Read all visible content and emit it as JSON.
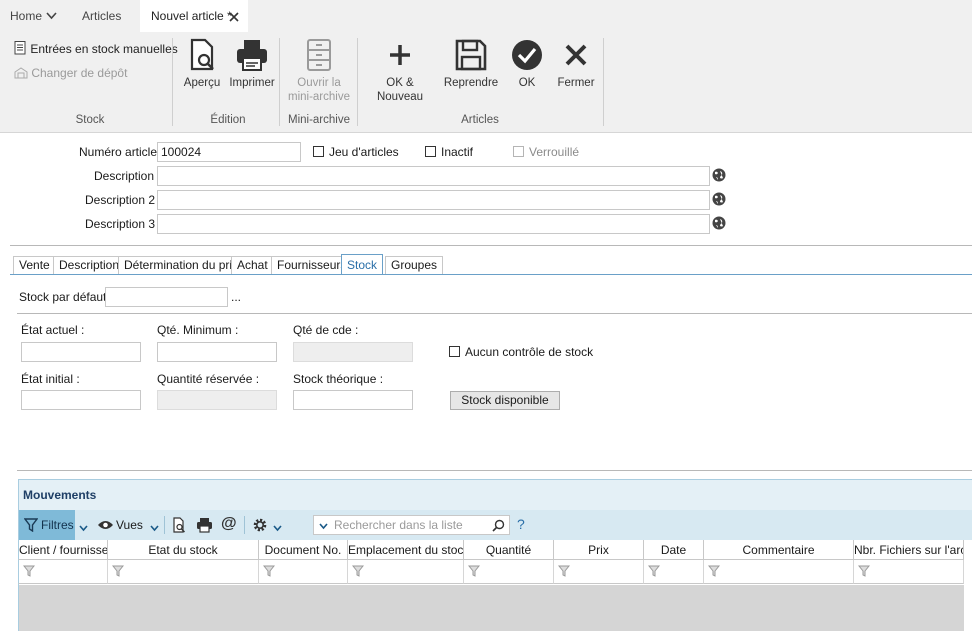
{
  "tabs": {
    "home": "Home",
    "articles": "Articles",
    "active": "Nouvel article *"
  },
  "ribbon": {
    "stock_manual": "Entrées en stock manuelles",
    "change_depot": "Changer de dépôt",
    "group_stock": "Stock",
    "apercu": "Aperçu",
    "imprimer": "Imprimer",
    "group_edition": "Édition",
    "ouvrir_line1": "Ouvrir la",
    "ouvrir_line2": "mini-archive",
    "group_mini": "Mini-archive",
    "ok_nouveau": "OK & Nouveau",
    "reprendre": "Reprendre",
    "ok": "OK",
    "fermer": "Fermer",
    "group_articles": "Articles"
  },
  "header": {
    "numero_label": "Numéro article :",
    "numero_value": "100024",
    "jeu_label": "Jeu d'articles",
    "inactif_label": "Inactif",
    "verrouille_label": "Verrouillé",
    "desc_label": "Description :",
    "desc2_label": "Description 2 :",
    "desc3_label": "Description 3 :",
    "desc_value": "",
    "desc2_value": "",
    "desc3_value": ""
  },
  "subtabs": [
    "Vente",
    "Description",
    "Détermination du prix",
    "Achat",
    "Fournisseurs",
    "Stock",
    "Groupes"
  ],
  "stock": {
    "stock_defaut_label": "Stock par défaut:",
    "stock_defaut_value": "",
    "browse": "...",
    "etat_actuel": "État actuel :",
    "qte_min": "Qté. Minimum :",
    "qte_cde": "Qté de cde :",
    "aucun_controle": "Aucun contrôle de stock",
    "etat_initial": "État initial :",
    "qte_reservee": "Quantité réservée :",
    "stock_theorique": "Stock théorique :",
    "stock_dispo_btn": "Stock disponible"
  },
  "movements": {
    "title": "Mouvements",
    "filtres": "Filtres",
    "vues": "Vues",
    "search_placeholder": "Rechercher dans la liste",
    "help": "?",
    "columns": [
      "Client / fournisseur",
      "Etat du stock",
      "Document No.",
      "Emplacement du stock",
      "Quantité",
      "Prix",
      "Date",
      "Commentaire",
      "Nbr. Fichiers sur l'arch."
    ]
  },
  "colors": {
    "accent": "#2a6fa8",
    "ribbon_bg": "#f0f0f0",
    "grid_header_bg": "#e4f0f6",
    "toolbar_bg": "#d7e9f2",
    "filter_active_bg": "#7fbad8"
  }
}
